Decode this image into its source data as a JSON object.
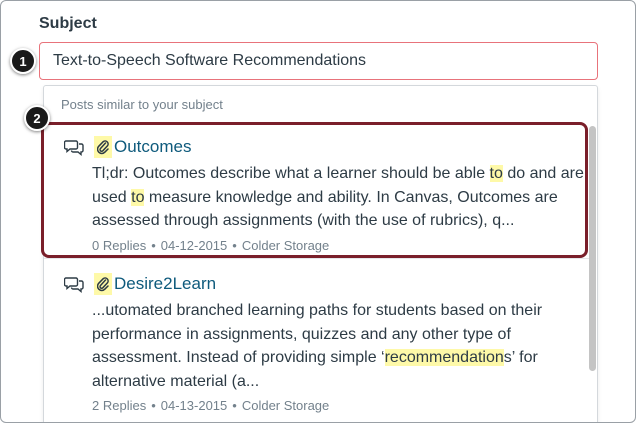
{
  "form": {
    "subject_label": "Subject",
    "subject_value": "Text-to-Speech Software Recommendations"
  },
  "suggestions": {
    "heading": "Posts similar to your subject",
    "posts": [
      {
        "title": "Outcomes",
        "body_parts": [
          {
            "text": "Tl;dr: Outcomes describe what a learner should be able ",
            "highlight": false
          },
          {
            "text": "to",
            "highlight": true
          },
          {
            "text": " do and are used ",
            "highlight": false
          },
          {
            "text": "to",
            "highlight": true
          },
          {
            "text": " measure knowledge and ability. In Canvas, Outcomes are assessed through assignments (with the use of rubrics), q...",
            "highlight": false
          }
        ],
        "replies": "0 Replies",
        "date": "04-12-2015",
        "author": "Colder Storage"
      },
      {
        "title": "Desire2Learn",
        "body_parts": [
          {
            "text": "...utomated branched learning paths for students based on their performance in assignments, quizzes and any other type of assessment. Instead of providing simple ‘",
            "highlight": false
          },
          {
            "text": "recommendation",
            "highlight": true
          },
          {
            "text": "s’ for alternative material (a...",
            "highlight": false
          }
        ],
        "replies": "2 Replies",
        "date": "04-13-2015",
        "author": "Colder Storage"
      }
    ]
  },
  "callouts": {
    "first": "1",
    "second": "2"
  },
  "colors": {
    "link": "#0e5a7c",
    "highlight": "#fef9a8",
    "annotation_border": "#7a1f2a",
    "input_border": "#e8737b"
  },
  "icons": {
    "discussion": "chat-bubbles-icon",
    "attachment": "paperclip-icon"
  },
  "meta_separator": "•"
}
